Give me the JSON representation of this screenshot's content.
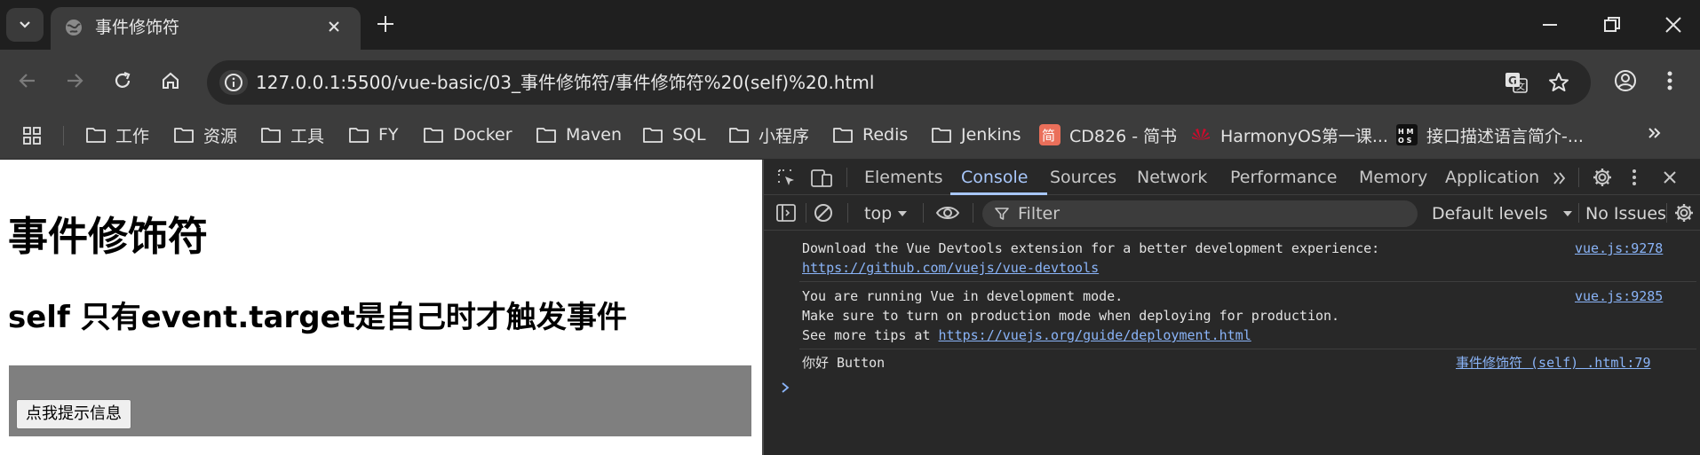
{
  "browser": {
    "tab_title": "事件修饰符",
    "url": "127.0.0.1:5500/vue-basic/03_事件修饰符/事件修饰符%20(self)%20.html"
  },
  "bookmarks": [
    {
      "label": "工作",
      "icon": "folder-icon"
    },
    {
      "label": "资源",
      "icon": "folder-icon"
    },
    {
      "label": "工具",
      "icon": "folder-icon"
    },
    {
      "label": "FY",
      "icon": "folder-icon"
    },
    {
      "label": "Docker",
      "icon": "folder-icon"
    },
    {
      "label": "Maven",
      "icon": "folder-icon"
    },
    {
      "label": "SQL",
      "icon": "folder-icon"
    },
    {
      "label": "小程序",
      "icon": "folder-icon"
    },
    {
      "label": "Redis",
      "icon": "folder-icon"
    },
    {
      "label": "Jenkins",
      "icon": "folder-icon"
    },
    {
      "label": "CD826 - 简书",
      "icon": "jianshu-icon"
    },
    {
      "label": "HarmonyOS第一课...",
      "icon": "huawei-icon"
    },
    {
      "label": "接口描述语言简介-...",
      "icon": "hmos-icon"
    }
  ],
  "page": {
    "heading": "事件修饰符",
    "subheading": "self 只有event.target是自己时才触发事件",
    "button_label": "点我提示信息"
  },
  "devtools": {
    "tabs": [
      "Elements",
      "Console",
      "Sources",
      "Network",
      "Performance",
      "Memory",
      "Application"
    ],
    "active_tab": "Console",
    "context": "top",
    "filter_placeholder": "Filter",
    "levels": "Default levels",
    "issues": "No Issues",
    "logs": {
      "l1_text": "Download the Vue Devtools extension for a better development experience:",
      "l1_link": "https://github.com/vuejs/vue-devtools",
      "l1_src": "vue.js:9278",
      "l2_line1": "You are running Vue in development mode.",
      "l2_line2": "Make sure to turn on production mode when deploying for production.",
      "l2_line3_prefix": "See more tips at ",
      "l2_link": "https://vuejs.org/guide/deployment.html",
      "l2_src": "vue.js:9285",
      "l3_text": "你好 Button",
      "l3_src": "事件修饰符 (self) .html:79"
    }
  },
  "colors": {
    "accent": "#a8c7fa",
    "link": "#8ab4f8",
    "gray_box": "#7f7f7f"
  }
}
